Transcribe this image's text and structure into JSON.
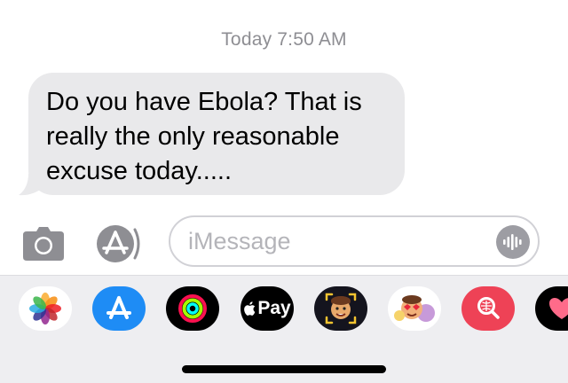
{
  "conversation": {
    "timestamp": "Today 7:50 AM",
    "messages": [
      {
        "direction": "incoming",
        "lines": [
          "Do you have Ebola? That is",
          "really the only reasonable",
          "excuse today....."
        ]
      }
    ]
  },
  "composer": {
    "placeholder": "iMessage",
    "camera_icon": "camera-icon",
    "apps_icon": "app-store-icon",
    "audio_icon": "audio-waveform-icon"
  },
  "app_drawer": {
    "items": [
      {
        "name": "photos-icon"
      },
      {
        "name": "app-store-icon"
      },
      {
        "name": "activity-rings-icon"
      },
      {
        "name": "apple-pay",
        "label": "Pay"
      },
      {
        "name": "memoji-icon"
      },
      {
        "name": "memoji-stickers-icon"
      },
      {
        "name": "image-search-icon"
      },
      {
        "name": "digital-touch-icon"
      }
    ]
  },
  "colors": {
    "incoming_bubble": "#e9e9eb",
    "timestamp": "#8e8e93",
    "drawer_background": "#eeeef1",
    "app_store_blue": "#1e8cf5",
    "search_red": "#ee4256"
  }
}
